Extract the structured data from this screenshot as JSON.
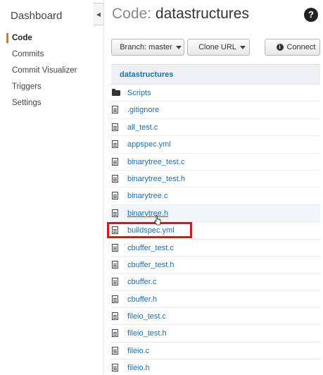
{
  "sidebar": {
    "title": "Dashboard",
    "items": [
      {
        "label": "Code",
        "active": true
      },
      {
        "label": "Commits",
        "active": false
      },
      {
        "label": "Commit Visualizer",
        "active": false
      },
      {
        "label": "Triggers",
        "active": false
      },
      {
        "label": "Settings",
        "active": false
      }
    ]
  },
  "header": {
    "title_prefix": "Code:",
    "title_repo": "datastructures",
    "help_glyph": "?"
  },
  "toolbar": {
    "branch_label": "Branch: master",
    "clone_label": "Clone URL",
    "connect_label": "Connect"
  },
  "table": {
    "header": "datastructures",
    "rows": [
      {
        "name": "Scripts",
        "type": "folder"
      },
      {
        "name": ".gitignore",
        "type": "file"
      },
      {
        "name": "all_test.c",
        "type": "file"
      },
      {
        "name": "appspec.yml",
        "type": "file"
      },
      {
        "name": "binarytree_test.c",
        "type": "file"
      },
      {
        "name": "binarytree_test.h",
        "type": "file"
      },
      {
        "name": "binarytree.c",
        "type": "file"
      },
      {
        "name": "binarytree.h",
        "type": "file",
        "hover": true
      },
      {
        "name": "buildspec.yml",
        "type": "file",
        "highlighted": true
      },
      {
        "name": "cbuffer_test.c",
        "type": "file"
      },
      {
        "name": "cbuffer_test.h",
        "type": "file"
      },
      {
        "name": "cbuffer.c",
        "type": "file"
      },
      {
        "name": "cbuffer.h",
        "type": "file"
      },
      {
        "name": "fileio_test.c",
        "type": "file"
      },
      {
        "name": "fileio_test.h",
        "type": "file"
      },
      {
        "name": "fileio.c",
        "type": "file"
      },
      {
        "name": "fileio.h",
        "type": "file"
      }
    ]
  },
  "colors": {
    "accent": "#ec7211",
    "link": "#1a6fb5",
    "highlight": "#e31313"
  }
}
